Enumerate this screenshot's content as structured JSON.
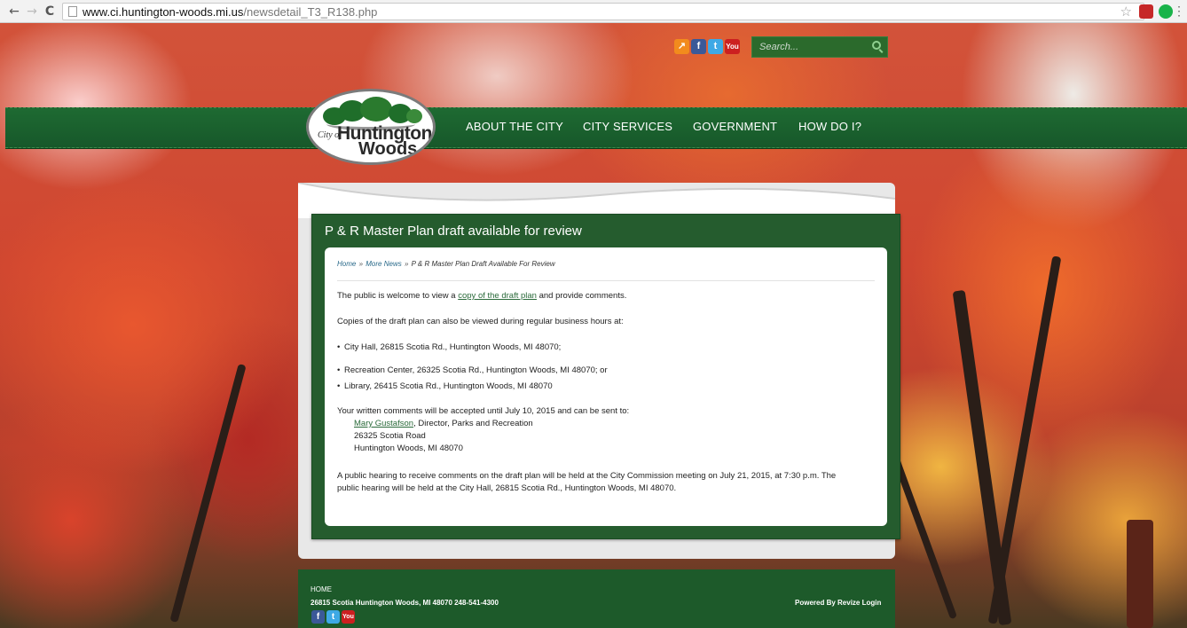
{
  "browser": {
    "url_host": "www.ci.huntington-woods.mi.us",
    "url_path": "/newsdetail_T3_R138.php",
    "back_glyph": "←",
    "forward_glyph": "→",
    "reload_glyph": "C",
    "star_glyph": "☆"
  },
  "header": {
    "search_placeholder": "Search...",
    "social_icons": [
      "share-icon",
      "facebook-icon",
      "twitter-icon",
      "youtube-icon"
    ]
  },
  "logo": {
    "city_text": "City of",
    "name_line1": "Huntington",
    "name_line2": "Woods"
  },
  "nav": {
    "items": [
      "ABOUT THE CITY",
      "CITY SERVICES",
      "GOVERNMENT",
      "HOW DO I?"
    ]
  },
  "article": {
    "title": "P & R Master Plan draft available for review",
    "breadcrumb": {
      "home": "Home",
      "sep": "»",
      "more_news": "More News",
      "current": "P & R Master Plan Draft Available For Review"
    },
    "p1_pre": "The public is welcome to view a ",
    "p1_link": "copy of the draft plan",
    "p1_post": " and provide comments.",
    "p2": "Copies of the draft plan can also be viewed during regular business hours at:",
    "locations": [
      "City Hall, 26815 Scotia Rd., Huntington Woods, MI   48070;",
      "Recreation Center, 26325 Scotia Rd., Huntington Woods, MI   48070; or",
      "Library, 26415 Scotia Rd., Huntington Woods, MI   48070"
    ],
    "p3": "Your written comments will be accepted until July 10, 2015 and can be sent to:",
    "contact_name": "Mary Gustafson",
    "contact_title": ", Director, Parks and Recreation",
    "contact_street": "26325 Scotia Road",
    "contact_city": "Huntington Woods, MI   48070",
    "p4_line1": "A public hearing to receive comments on the draft plan will be held at the City Commission meeting on July 21, 2015, at 7:30 p.m.  The",
    "p4_line2": "public hearing will be held at the City Hall, 26815 Scotia Rd., Huntington Woods, MI  48070."
  },
  "footer": {
    "home": "HOME",
    "address": "26815 Scotia Huntington Woods, MI 48070 248-541-4300",
    "powered": "Powered By Revize Login"
  },
  "colors": {
    "nav_green": "#1e6a32",
    "panel_green": "#255c2e",
    "link_green": "#2a6a3a"
  }
}
